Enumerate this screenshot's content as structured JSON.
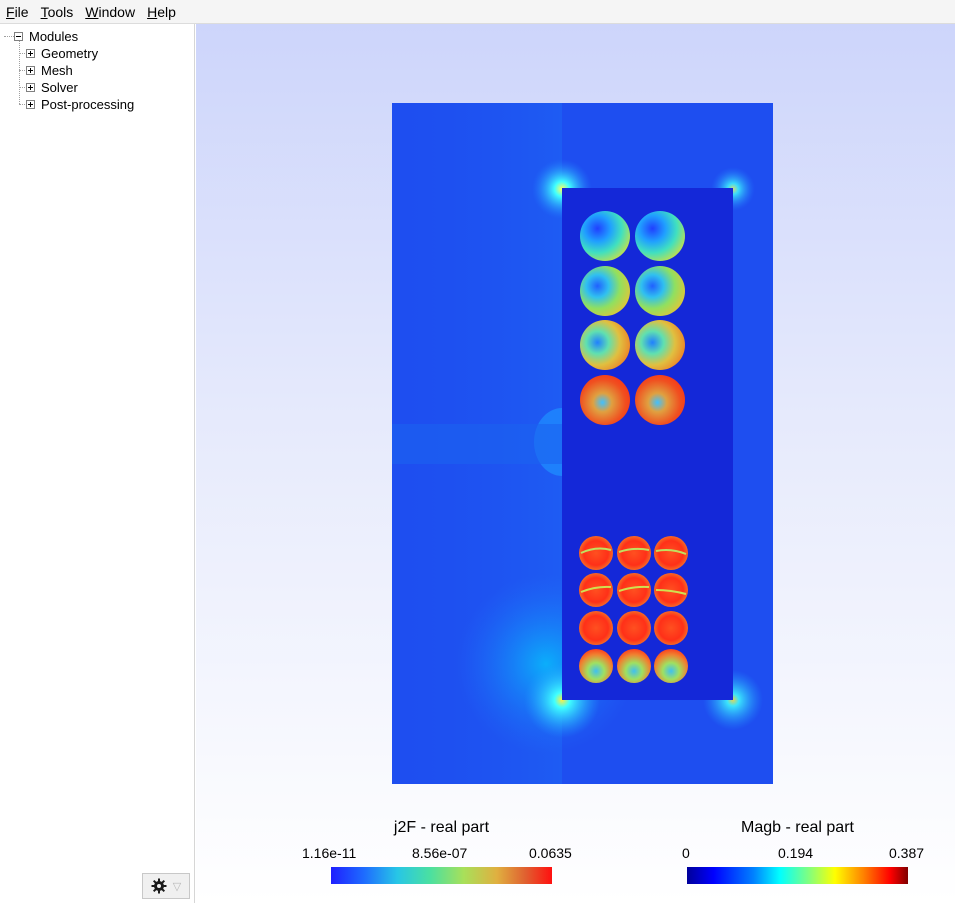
{
  "menu": [
    {
      "accel": "F",
      "rest": "ile"
    },
    {
      "accel": "T",
      "rest": "ools"
    },
    {
      "accel": "W",
      "rest": "indow"
    },
    {
      "accel": "H",
      "rest": "elp"
    }
  ],
  "tree": {
    "root": "Modules",
    "children": [
      "Geometry",
      "Mesh",
      "Solver",
      "Post-processing"
    ]
  },
  "toolbar": {
    "gear_icon": "gear-icon",
    "filter_icon": "filter-triangle-icon"
  },
  "scales": [
    {
      "title": "j2F - real part",
      "ticks": [
        "1.16e-11",
        "8.56e-07",
        "0.0635"
      ],
      "colors": [
        "#1f1fff",
        "#1e6cff",
        "#27c6e6",
        "#4be0a0",
        "#a8e05a",
        "#e0b040",
        "#e06030",
        "#ff1010"
      ]
    },
    {
      "title": "Magb - real part",
      "ticks": [
        "0",
        "0.194",
        "0.387"
      ],
      "colors": [
        "#00009a",
        "#0000ff",
        "#0080ff",
        "#00ffff",
        "#80ff80",
        "#ffff00",
        "#ff8000",
        "#ff0000",
        "#800000"
      ]
    }
  ]
}
